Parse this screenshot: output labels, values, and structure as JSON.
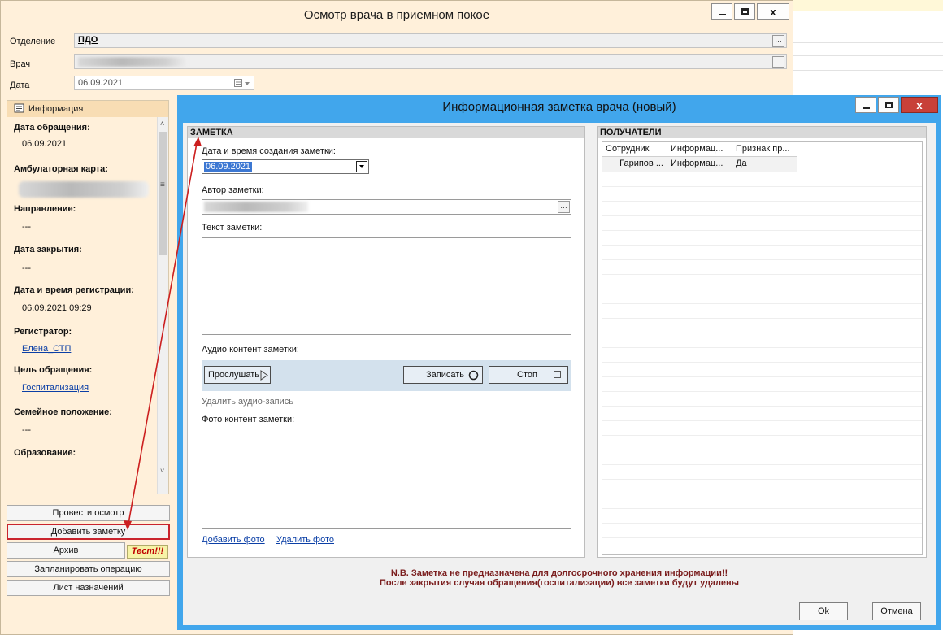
{
  "main_window": {
    "title": "Осмотр врача в приемном покое",
    "fields": {
      "department_label": "Отделение",
      "department_value": "ПДО",
      "doctor_label": "Врач",
      "date_label": "Дата",
      "date_value": "06.09.2021"
    },
    "info_panel": {
      "header": "Информация",
      "items": [
        {
          "title": "Дата обращения:",
          "value": "06.09.2021"
        },
        {
          "title": "Амбулаторная карта:",
          "value": ""
        },
        {
          "title": "Направление:",
          "value": "---"
        },
        {
          "title": "Дата закрытия:",
          "value": "---"
        },
        {
          "title": "Дата и время регистрации:",
          "value": "06.09.2021 09:29"
        },
        {
          "title": "Регистратор:",
          "value": "Елена_СТП"
        },
        {
          "title": "Цель обращения:",
          "value": "Госпитализация"
        },
        {
          "title": "Семейное положение:",
          "value": "---"
        },
        {
          "title": "Образование:",
          "value": ""
        }
      ]
    },
    "buttons": {
      "examine": "Провести осмотр",
      "add_note": "Добавить заметку",
      "archive": "Архив",
      "test_badge": "Тест!!!",
      "plan_operation": "Запланировать операцию",
      "prescriptions": "Лист назначений"
    }
  },
  "note_dialog": {
    "title": "Информационная заметка врача (новый)",
    "note_section": {
      "header": "ЗАМЕТКА",
      "created_label": "Дата и время создания заметки:",
      "created_value": "06.09.2021",
      "author_label": "Автор заметки:",
      "text_label": "Текст заметки:",
      "audio_label": "Аудио контент заметки:",
      "play_button": "Прослушать",
      "record_button": "Записать",
      "stop_button": "Стоп",
      "delete_audio": "Удалить аудио-запись",
      "photo_label": "Фото контент заметки:",
      "add_photo": "Добавить фото",
      "delete_photo": "Удалить фото"
    },
    "recipients_section": {
      "header": "ПОЛУЧАТЕЛИ",
      "columns": [
        "Сотрудник",
        "Информац...",
        "Признак пр..."
      ],
      "rows": [
        [
          "Гарипов ...",
          "Информац...",
          "Да"
        ]
      ]
    },
    "warning_line1": "N.B. Заметка не предназначена для долгосрочного хранения информации!!",
    "warning_line2": "После закрытия случая обращения(госпитализации) все заметки будут удалены",
    "ok_button": "Ok",
    "cancel_button": "Отмена"
  },
  "colors": {
    "main_window_bg": "#fff0da",
    "dialog_frame": "#41a6ec",
    "annotation": "#cc1f1f",
    "link": "#0b3fa6",
    "test_badge_text": "#c00000",
    "warning_text": "#7a1d1d"
  }
}
